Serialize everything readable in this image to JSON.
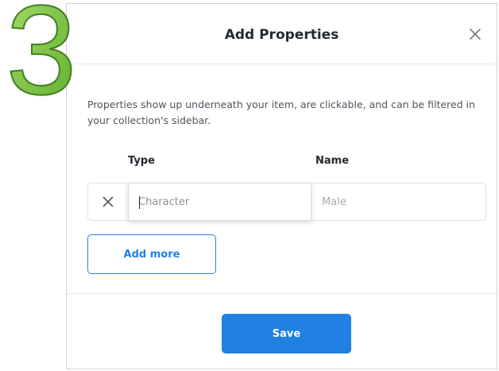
{
  "step_badge": {
    "number": "3",
    "color": "#7cc243"
  },
  "modal": {
    "title": "Add Properties",
    "close_icon": "close-icon",
    "description": "Properties show up underneath your item, are clickable, and can be filtered in your collection's sidebar.",
    "columns": {
      "type_label": "Type",
      "name_label": "Name"
    },
    "property_row": {
      "remove_icon": "close-icon",
      "type_value": "",
      "type_placeholder": "Character",
      "name_value": "",
      "name_placeholder": "Male"
    },
    "add_more_label": "Add more",
    "save_label": "Save"
  },
  "colors": {
    "accent": "#2081e2",
    "border": "#e0e3e7",
    "title_text": "#232a31",
    "body_text": "#4c5660"
  }
}
